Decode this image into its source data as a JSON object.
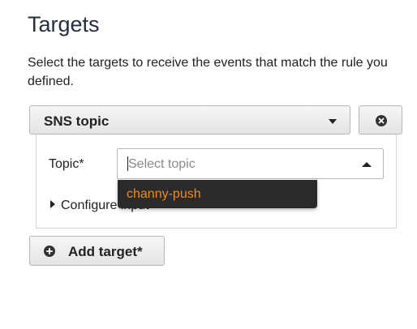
{
  "section": {
    "title": "Targets",
    "description": "Select the targets to receive the events that match the rule you defined."
  },
  "target": {
    "type_value": "SNS topic",
    "type_caret_icon": "caret-down-icon",
    "remove_icon": "close-circle-icon"
  },
  "topic": {
    "label": "Topic*",
    "placeholder": "Select topic",
    "caret_icon": "caret-up-icon",
    "options": [
      {
        "label": "channy-push"
      }
    ]
  },
  "configure_input": {
    "label": "Configure input",
    "icon": "disclosure-triangle-icon"
  },
  "add_target": {
    "label": "Add target*",
    "icon": "plus-circle-icon"
  },
  "colors": {
    "option_text": "#f08a24",
    "dropdown_bg": "#2a2a2a"
  }
}
